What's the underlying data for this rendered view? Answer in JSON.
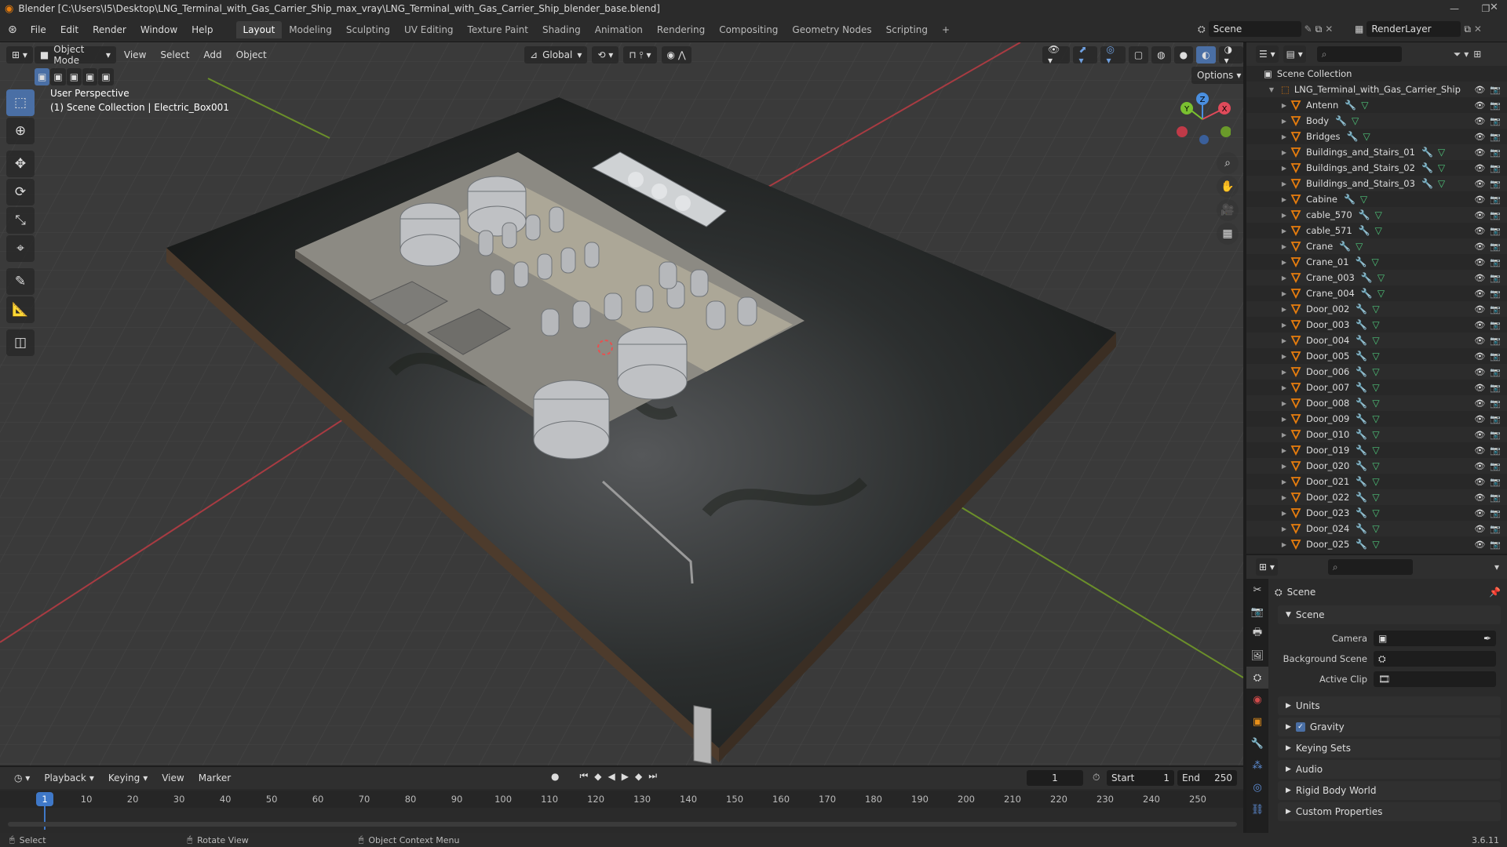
{
  "title_bar": {
    "text": "Blender [C:\\Users\\I5\\Desktop\\LNG_Terminal_with_Gas_Carrier_Ship_max_vray\\LNG_Terminal_with_Gas_Carrier_Ship_blender_base.blend]"
  },
  "menu": {
    "items": [
      "File",
      "Edit",
      "Render",
      "Window",
      "Help"
    ]
  },
  "workspaces": [
    "Layout",
    "Modeling",
    "Sculpting",
    "UV Editing",
    "Texture Paint",
    "Shading",
    "Animation",
    "Rendering",
    "Compositing",
    "Geometry Nodes",
    "Scripting"
  ],
  "workspace_add": "+",
  "scene_field": "Scene",
  "render_layer_field": "RenderLayer",
  "viewport": {
    "mode": "Object Mode",
    "menus": [
      "View",
      "Select",
      "Add",
      "Object"
    ],
    "transform_orientation": "Global",
    "options_label": "Options",
    "overlay_line1": "User Perspective",
    "overlay_line2": "(1) Scene Collection | Electric_Box001",
    "gizmo_axes": [
      "Z",
      "Y",
      "X"
    ]
  },
  "outliner": {
    "root": "Scene Collection",
    "collection": "LNG_Terminal_with_Gas_Carrier_Ship",
    "objects": [
      "Antenn",
      "Body",
      "Bridges",
      "Buildings_and_Stairs_01",
      "Buildings_and_Stairs_02",
      "Buildings_and_Stairs_03",
      "Cabine",
      "cable_570",
      "cable_571",
      "Crane",
      "Crane_01",
      "Crane_003",
      "Crane_004",
      "Door_002",
      "Door_003",
      "Door_004",
      "Door_005",
      "Door_006",
      "Door_007",
      "Door_008",
      "Door_009",
      "Door_010",
      "Door_019",
      "Door_020",
      "Door_021",
      "Door_022",
      "Door_023",
      "Door_024",
      "Door_025"
    ]
  },
  "properties": {
    "header": "Scene",
    "section_scene": "Scene",
    "camera_label": "Camera",
    "background_scene_label": "Background Scene",
    "active_clip_label": "Active Clip",
    "panels": [
      "Units",
      "Gravity",
      "Keying Sets",
      "Audio",
      "Rigid Body World",
      "Custom Properties"
    ],
    "gravity_checked": true
  },
  "timeline": {
    "menus": [
      "Playback",
      "Keying",
      "View",
      "Marker"
    ],
    "current_frame": "1",
    "start_label": "Start",
    "start_value": "1",
    "end_label": "End",
    "end_value": "250",
    "ruler": [
      "1",
      "10",
      "20",
      "30",
      "40",
      "50",
      "60",
      "70",
      "80",
      "90",
      "100",
      "110",
      "120",
      "130",
      "140",
      "150",
      "160",
      "170",
      "180",
      "190",
      "200",
      "210",
      "220",
      "230",
      "240",
      "250"
    ]
  },
  "status_bar": {
    "select": "Select",
    "rotate": "Rotate View",
    "context": "Object Context Menu",
    "version": "3.6.11"
  },
  "colors": {
    "accent": "#4a6fa5",
    "mesh_orange": "#e87d0d",
    "modifier_blue": "#5f8fd8",
    "mesh_green": "#4ec57a",
    "frame_blue": "#3f78c8"
  }
}
